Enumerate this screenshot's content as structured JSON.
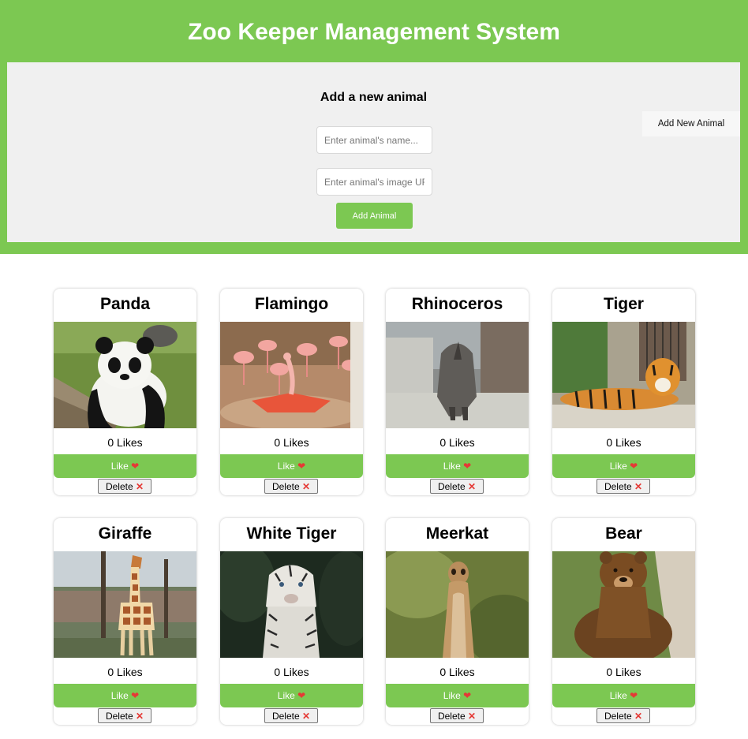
{
  "header": {
    "title": "Zoo Keeper Management System"
  },
  "form": {
    "heading": "Add a new animal",
    "name_placeholder": "Enter animal's name...",
    "url_placeholder": "Enter animal's image URL...",
    "submit_label": "Add Animal",
    "toggle_label": "Add New Animal"
  },
  "colors": {
    "accent": "#7cc852",
    "panel": "#f0f0f0",
    "heart": "#e53935"
  },
  "animals": [
    {
      "name": "Panda",
      "likes": "0 Likes",
      "like_label": "Like",
      "delete_label": "Delete",
      "image": "panda-photo"
    },
    {
      "name": "Flamingo",
      "likes": "0 Likes",
      "like_label": "Like",
      "delete_label": "Delete",
      "image": "flamingo-photo"
    },
    {
      "name": "Rhinoceros",
      "likes": "0 Likes",
      "like_label": "Like",
      "delete_label": "Delete",
      "image": "rhinoceros-photo"
    },
    {
      "name": "Tiger",
      "likes": "0 Likes",
      "like_label": "Like",
      "delete_label": "Delete",
      "image": "tiger-photo"
    },
    {
      "name": "Giraffe",
      "likes": "0 Likes",
      "like_label": "Like",
      "delete_label": "Delete",
      "image": "giraffe-photo"
    },
    {
      "name": "White Tiger",
      "likes": "0 Likes",
      "like_label": "Like",
      "delete_label": "Delete",
      "image": "white-tiger-photo"
    },
    {
      "name": "Meerkat",
      "likes": "0 Likes",
      "like_label": "Like",
      "delete_label": "Delete",
      "image": "meerkat-photo"
    },
    {
      "name": "Bear",
      "likes": "0 Likes",
      "like_label": "Like",
      "delete_label": "Delete",
      "image": "bear-photo"
    }
  ]
}
